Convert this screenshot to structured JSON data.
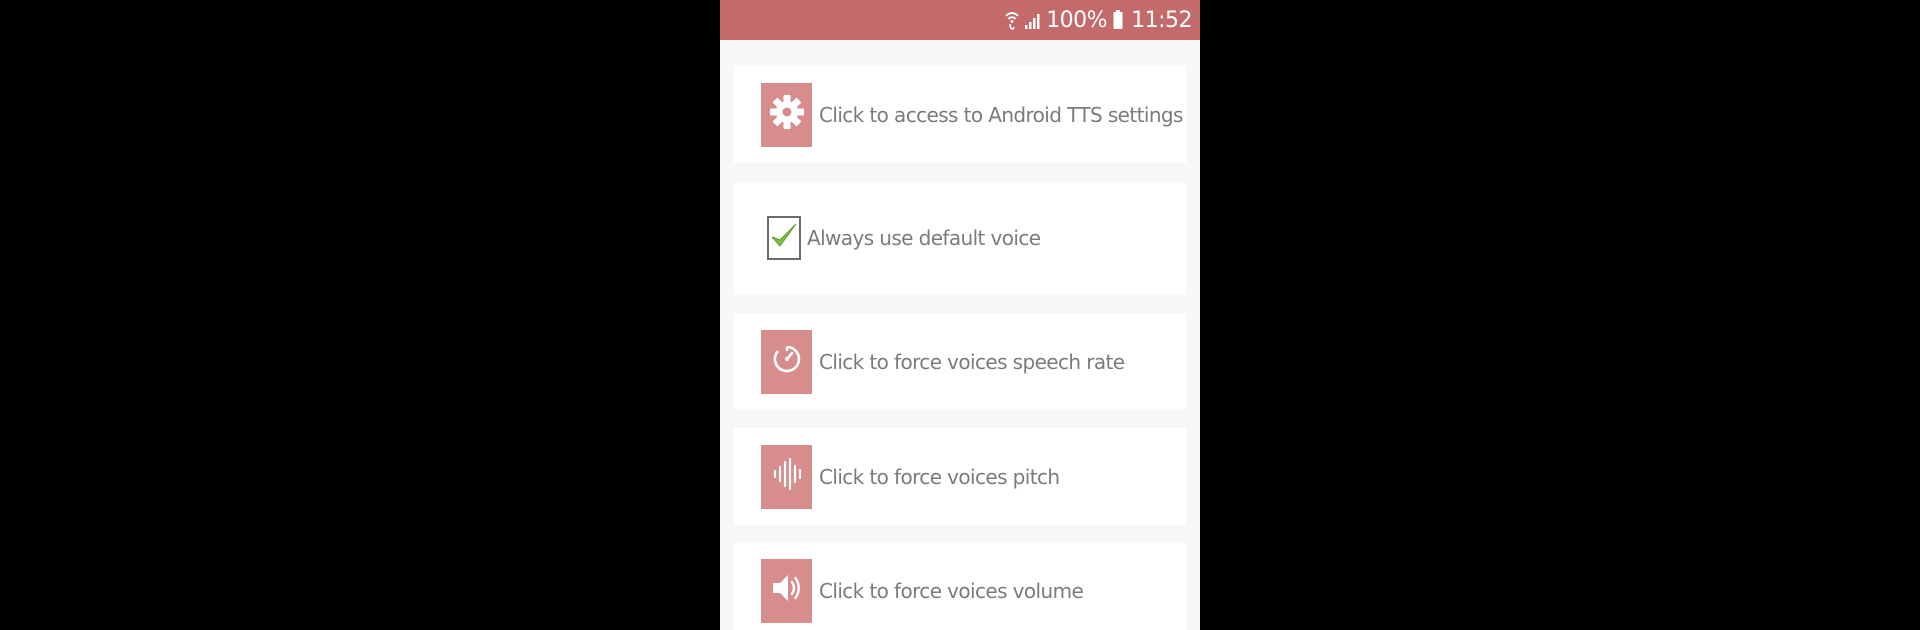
{
  "status_bar": {
    "battery": "100%",
    "time": "11:52",
    "icons": [
      "wifi-calling-icon",
      "signal-icon",
      "battery-icon"
    ],
    "color": "#c26b6a"
  },
  "settings": [
    {
      "type": "action",
      "icon": "gear-icon",
      "label": "Click to access to Android TTS settings"
    },
    {
      "type": "checkbox",
      "icon": "checkmark-icon",
      "checked": true,
      "label": "Always use default voice"
    },
    {
      "type": "action",
      "icon": "speedometer-icon",
      "label": "Click to force voices speech rate"
    },
    {
      "type": "action",
      "icon": "waveform-icon",
      "label": "Click to force voices pitch"
    },
    {
      "type": "action",
      "icon": "speaker-icon",
      "label": "Click to force voices volume"
    }
  ],
  "colors": {
    "accent": "#c26b6a",
    "tile": "#d68d8c",
    "check": "#7ac143",
    "text": "#7b7b7b"
  }
}
